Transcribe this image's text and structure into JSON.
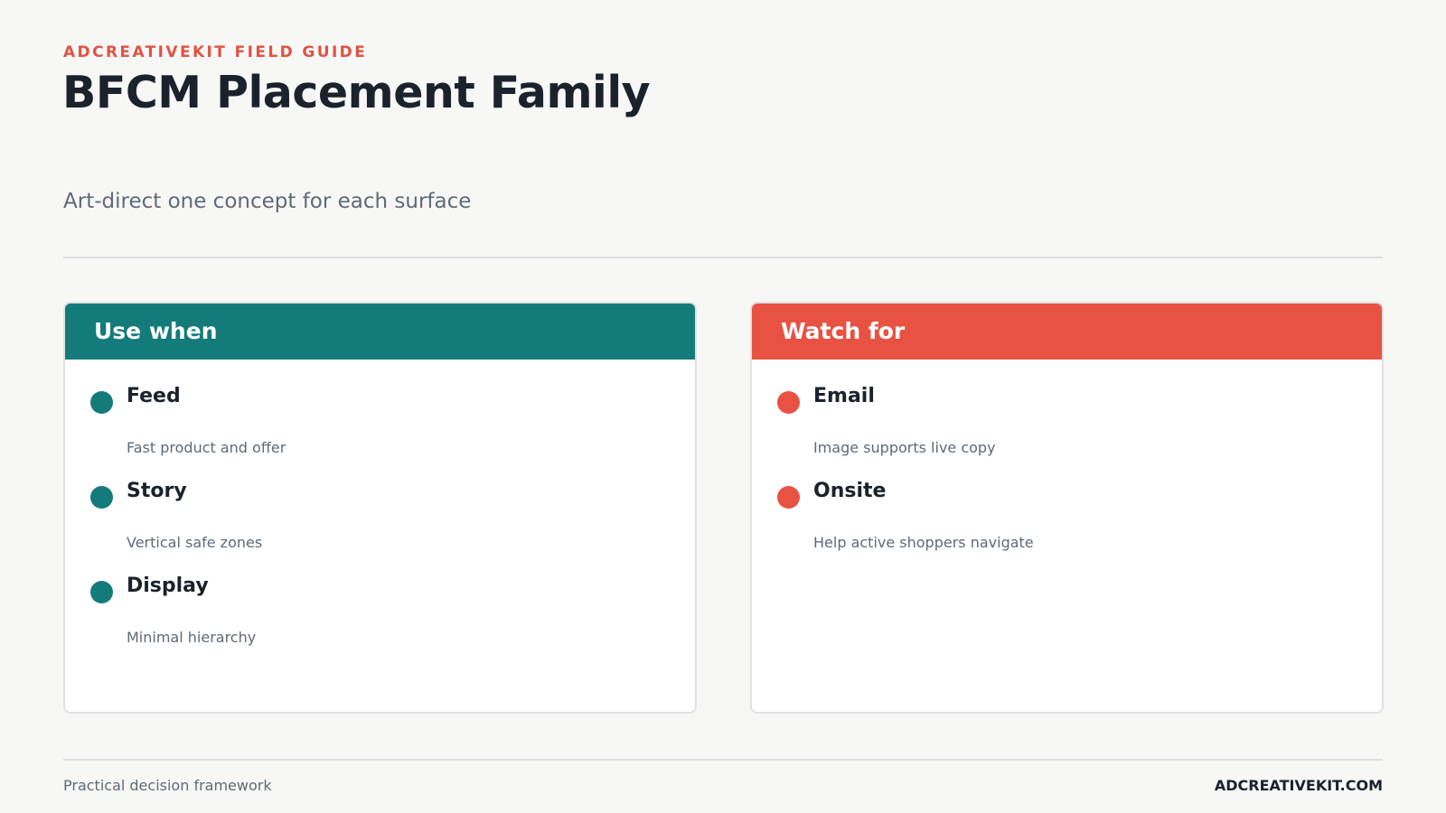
{
  "header": {
    "eyebrow": "ADCREATIVEKIT FIELD GUIDE",
    "title": "BFCM Placement Family",
    "subtitle": "Art-direct one concept for each surface"
  },
  "cards": {
    "use_when": {
      "heading": "Use when",
      "color": "#147b7b",
      "items": [
        {
          "label": "Feed",
          "desc": "Fast product and offer"
        },
        {
          "label": "Story",
          "desc": "Vertical safe zones"
        },
        {
          "label": "Display",
          "desc": "Minimal hierarchy"
        }
      ]
    },
    "watch_for": {
      "heading": "Watch for",
      "color": "#e75243",
      "items": [
        {
          "label": "Email",
          "desc": "Image supports live copy"
        },
        {
          "label": "Onsite",
          "desc": "Help active shoppers navigate"
        }
      ]
    }
  },
  "footer": {
    "left": "Practical decision framework",
    "right": "ADCREATIVEKIT.COM"
  }
}
